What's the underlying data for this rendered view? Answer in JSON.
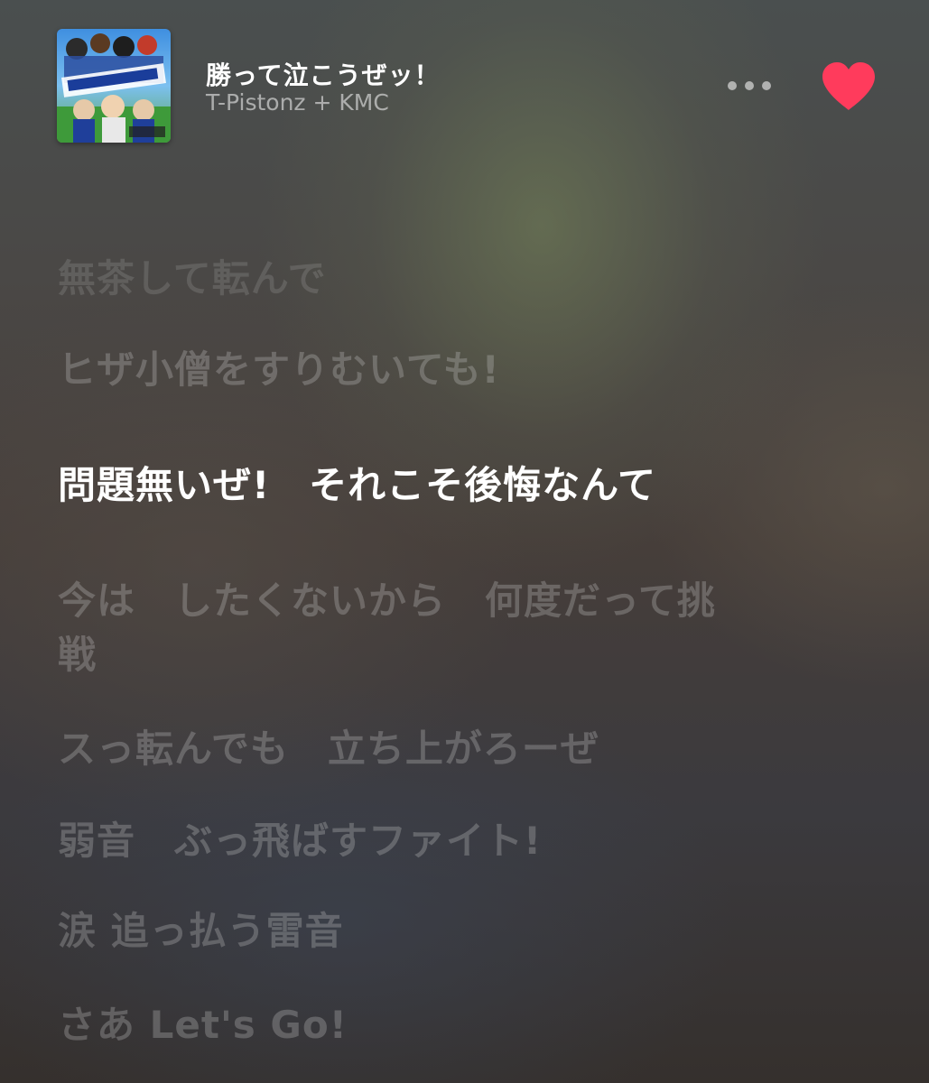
{
  "now_playing": {
    "title": "勝って泣こうぜッ！",
    "artist": "T-Pistonz + KMC",
    "album_art": "album-artwork",
    "more_icon": "ellipsis-icon",
    "love_icon": "heart-icon",
    "loved": true,
    "accent_color": "#ff3b5c"
  },
  "lyrics": {
    "active_index": 2,
    "lines": [
      "無茶して転んで",
      "ヒザ小僧をすりむいても!",
      "問題無いぜ!　それこそ後悔なんて",
      "今は　したくないから　何度だって挑戦",
      "スっ転んでも　立ち上がろーぜ",
      "弱音　ぶっ飛ばすファイト!",
      "涙 追っ払う雷音",
      "さあ Let's Go!"
    ]
  }
}
